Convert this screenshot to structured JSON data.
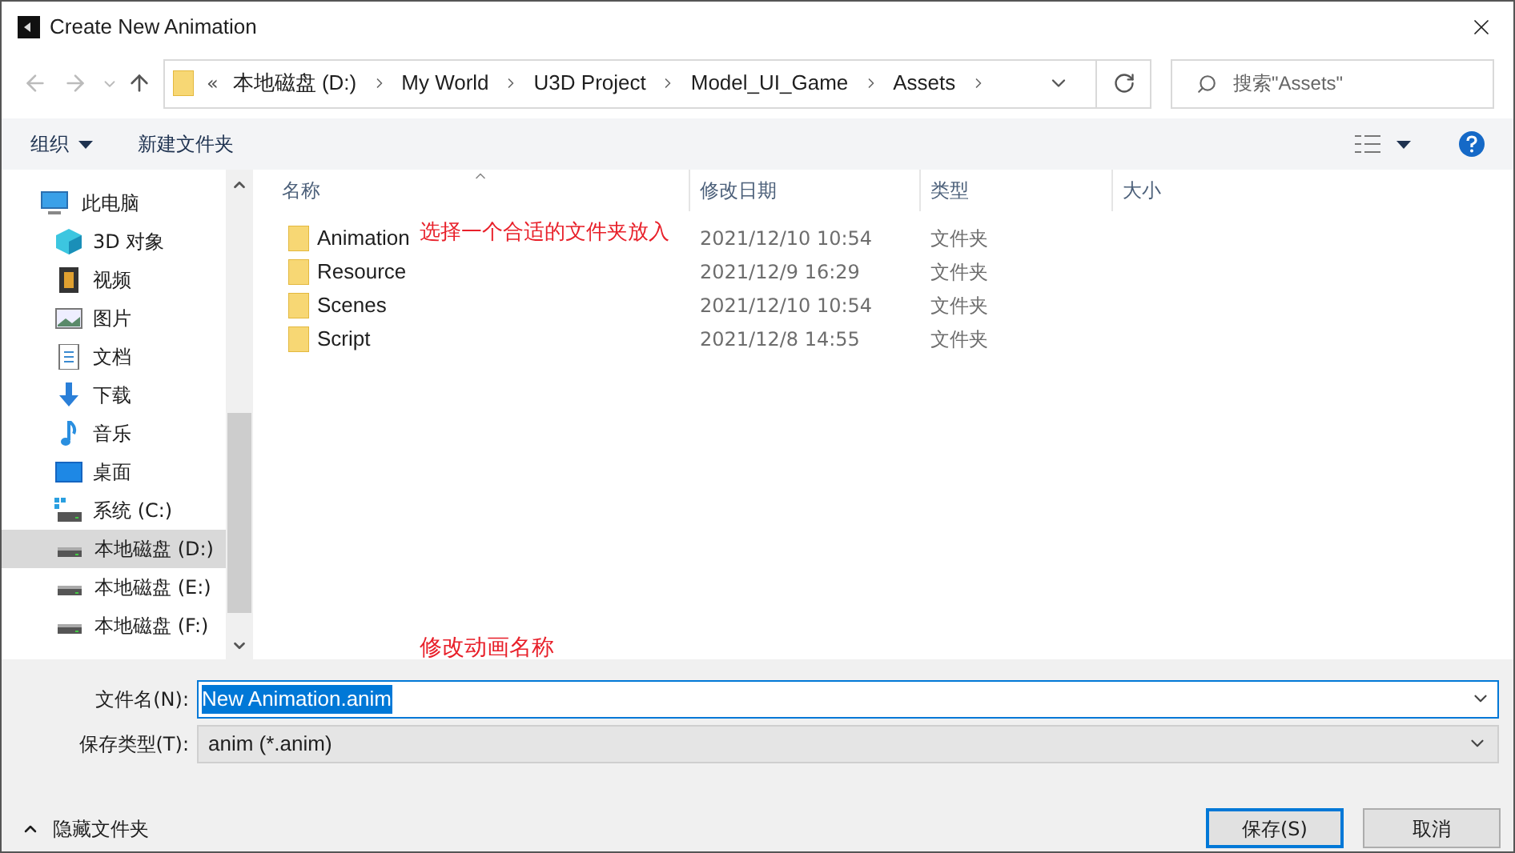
{
  "window": {
    "title": "Create New Animation"
  },
  "address": {
    "overflow": "«",
    "crumbs": [
      "本地磁盘 (D:)",
      "My World",
      "U3D Project",
      "Model_UI_Game",
      "Assets"
    ]
  },
  "search": {
    "placeholder": "搜索\"Assets\""
  },
  "toolbar": {
    "organize": "组织",
    "new_folder": "新建文件夹"
  },
  "sidebar": {
    "items": [
      {
        "label": "此电脑",
        "kind": "pc",
        "selected": false
      },
      {
        "label": "3D 对象",
        "kind": "cube",
        "selected": false
      },
      {
        "label": "视频",
        "kind": "video",
        "selected": false
      },
      {
        "label": "图片",
        "kind": "image",
        "selected": false
      },
      {
        "label": "文档",
        "kind": "doc",
        "selected": false
      },
      {
        "label": "下载",
        "kind": "download",
        "selected": false
      },
      {
        "label": "音乐",
        "kind": "music",
        "selected": false
      },
      {
        "label": "桌面",
        "kind": "desktop",
        "selected": false
      },
      {
        "label": "系统 (C:)",
        "kind": "sysdrive",
        "selected": false
      },
      {
        "label": "本地磁盘 (D:)",
        "kind": "drive",
        "selected": true
      },
      {
        "label": "本地磁盘 (E:)",
        "kind": "drive",
        "selected": false
      },
      {
        "label": "本地磁盘 (F:)",
        "kind": "drive",
        "selected": false
      }
    ]
  },
  "table": {
    "columns": [
      "名称",
      "修改日期",
      "类型",
      "大小"
    ],
    "rows": [
      {
        "name": "Animation",
        "date": "2021/12/10 10:54",
        "type": "文件夹"
      },
      {
        "name": "Resource",
        "date": "2021/12/9 16:29",
        "type": "文件夹"
      },
      {
        "name": "Scenes",
        "date": "2021/12/10 10:54",
        "type": "文件夹"
      },
      {
        "name": "Script",
        "date": "2021/12/8 14:55",
        "type": "文件夹"
      }
    ]
  },
  "annotations": [
    "选择一个合适的文件夹放入",
    "修改动画名称"
  ],
  "form": {
    "filename_label": "文件名(N):",
    "filename_value": "New Animation.anim",
    "type_label": "保存类型(T):",
    "type_value": "anim (*.anim)"
  },
  "hide_folders": "隐藏文件夹",
  "buttons": [
    "保存(S)",
    "取消"
  ]
}
